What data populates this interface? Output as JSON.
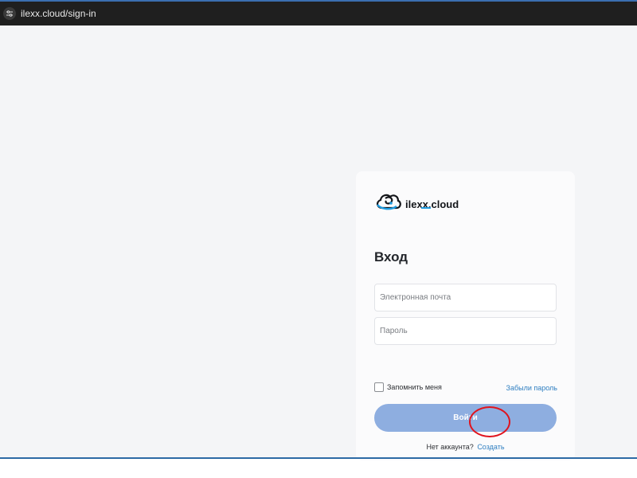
{
  "browser": {
    "url": "ilexx.cloud/sign-in",
    "site_info_icon": "tune-icon"
  },
  "colors": {
    "page_background": "#f4f5f7",
    "accent": "#2f7fc1",
    "button_background": "#8eaee0",
    "annotation": "#e0131d"
  },
  "login": {
    "logo_text": "ilexx.cloud",
    "logo_icon": "cloud-spiral-icon",
    "title": "Вход",
    "email_placeholder": "Электронная почта",
    "email_value": "",
    "password_placeholder": "Пароль",
    "password_value": "",
    "remember_label": "Запомнить меня",
    "remember_checked": false,
    "forgot_label": "Забыли пароль",
    "submit_label": "Войти",
    "no_account_text": "Нет аккаунта?",
    "signup_label": "Создать"
  }
}
